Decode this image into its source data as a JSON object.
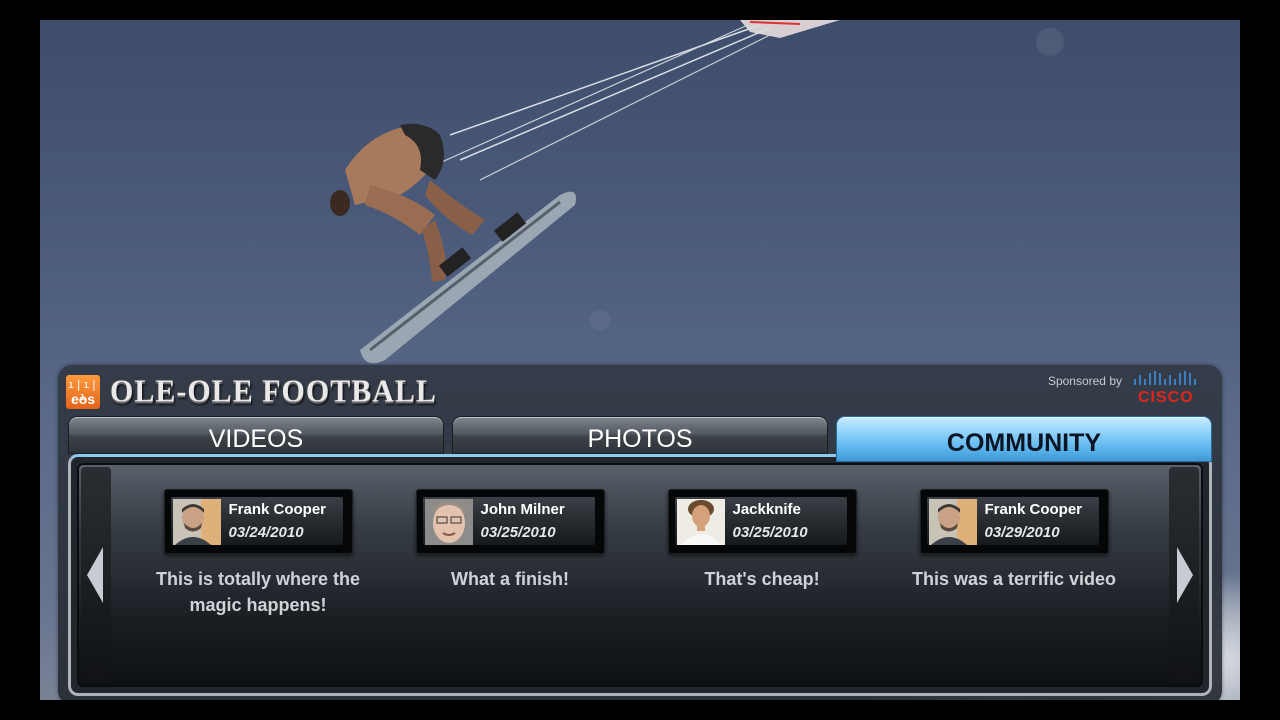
{
  "brand": {
    "logo_text": "eos",
    "logo_bars": "ı|ı|ı",
    "title": "OLE-OLE FOOTBALL"
  },
  "sponsor": {
    "label": "Sponsored by",
    "logo_text": "CISCO"
  },
  "tabs": [
    {
      "label": "VIDEOS",
      "active": false
    },
    {
      "label": "PHOTOS",
      "active": false
    },
    {
      "label": "COMMUNITY",
      "active": true
    }
  ],
  "colors": {
    "active_tab": "#5fb6ec",
    "inactive_tab": "#555b63",
    "cisco_red": "#e1251b",
    "eos_orange": "#f07a2a"
  },
  "comments": [
    {
      "name": "Frank Cooper",
      "date": "03/24/2010",
      "text": "This is totally where the magic happens!",
      "avatar": "bearded-man"
    },
    {
      "name": "John Milner",
      "date": "03/25/2010",
      "text": "What a finish!",
      "avatar": "older-man"
    },
    {
      "name": "Jackknife",
      "date": "03/25/2010",
      "text": "That's cheap!",
      "avatar": "curly-hair-man"
    },
    {
      "name": "Frank Cooper",
      "date": "03/29/2010",
      "text": "This was a terrific video",
      "avatar": "bearded-man"
    }
  ]
}
